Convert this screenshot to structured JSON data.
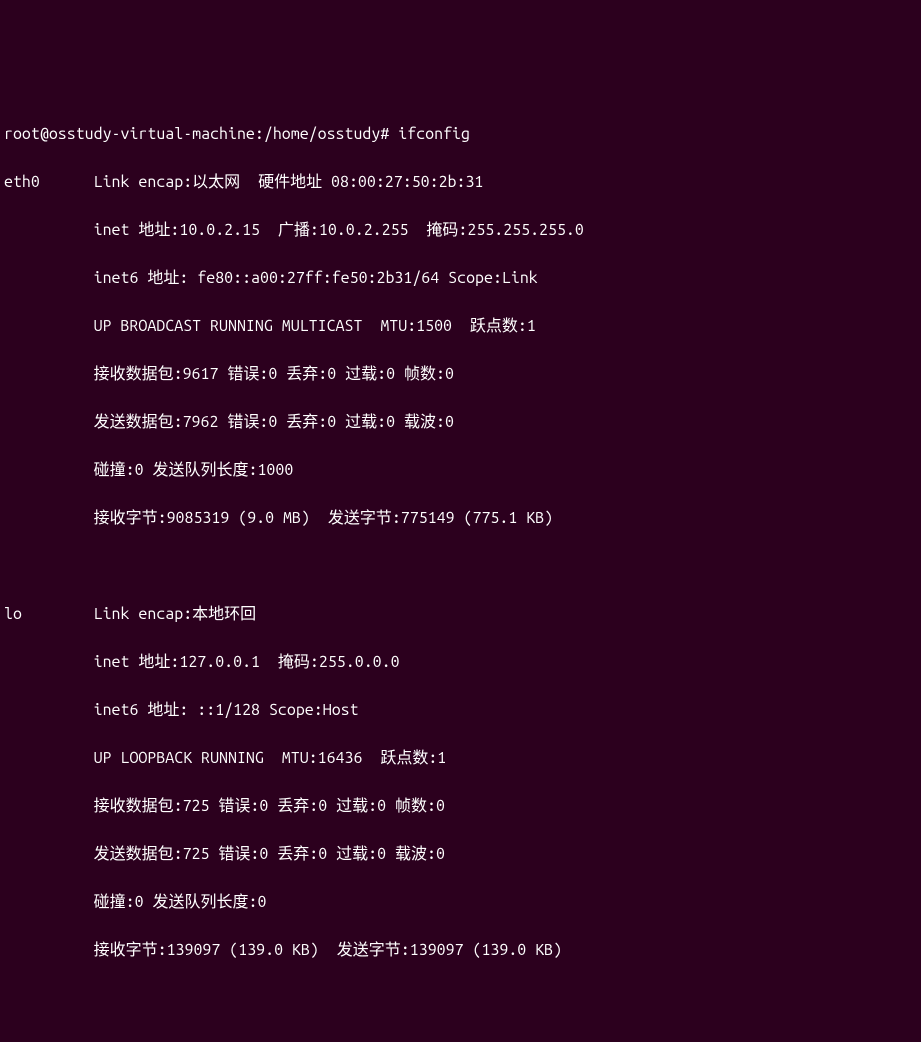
{
  "prompt": {
    "user": "root",
    "host": "osstudy-virtual-machine",
    "path": "/home/osstudy",
    "symbol": "#",
    "command": "ifconfig"
  },
  "interfaces": [
    {
      "name": "eth0",
      "lines": [
        "Link encap:以太网  硬件地址 08:00:27:50:2b:31",
        "inet 地址:10.0.2.15  广播:10.0.2.255  掩码:255.255.255.0",
        "inet6 地址: fe80::a00:27ff:fe50:2b31/64 Scope:Link",
        "UP BROADCAST RUNNING MULTICAST  MTU:1500  跃点数:1",
        "接收数据包:9617 错误:0 丢弃:0 过载:0 帧数:0",
        "发送数据包:7962 错误:0 丢弃:0 过载:0 载波:0",
        "碰撞:0 发送队列长度:1000",
        "接收字节:9085319 (9.0 MB)  发送字节:775149 (775.1 KB)"
      ]
    },
    {
      "name": "lo",
      "lines": [
        "Link encap:本地环回",
        "inet 地址:127.0.0.1  掩码:255.0.0.0",
        "inet6 地址: ::1/128 Scope:Host",
        "UP LOOPBACK RUNNING  MTU:16436  跃点数:1",
        "接收数据包:725 错误:0 丢弃:0 过载:0 帧数:0",
        "发送数据包:725 错误:0 丢弃:0 过载:0 载波:0",
        "碰撞:0 发送队列长度:0",
        "接收字节:139097 (139.0 KB)  发送字节:139097 (139.0 KB)"
      ]
    }
  ]
}
